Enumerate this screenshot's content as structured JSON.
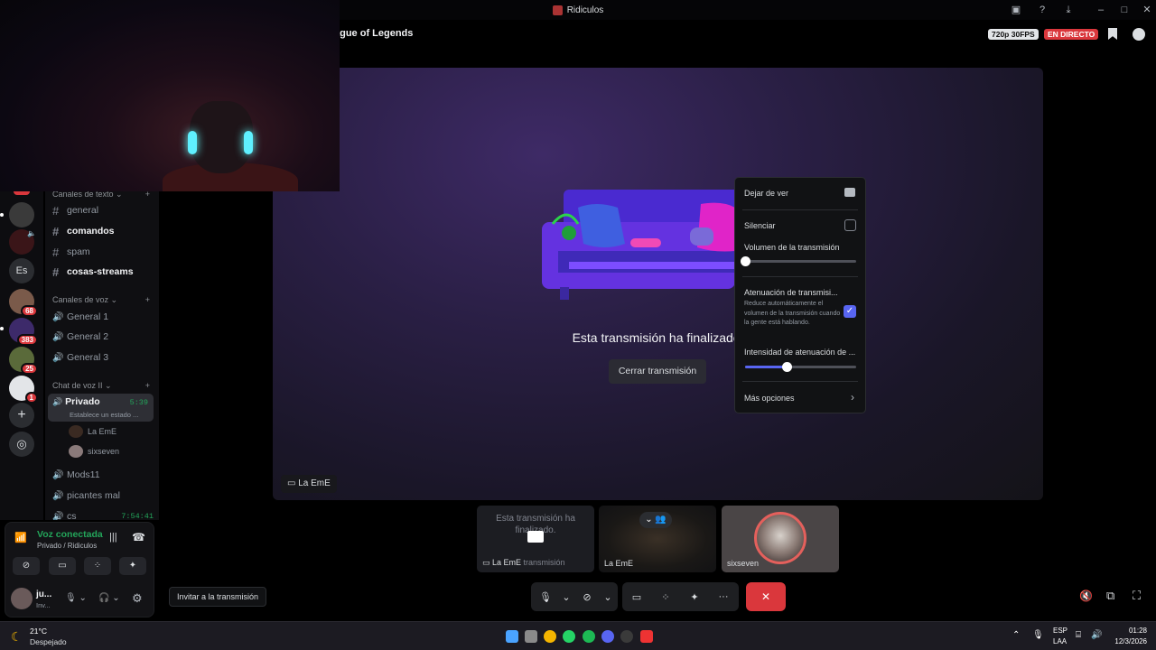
{
  "window": {
    "title": "Ridiculos"
  },
  "stream": {
    "title": "ague of Legends",
    "quality": "720p 30FPS",
    "live_badge": "EN DIRECTO",
    "ended_text": "Esta transmisión ha finalizado.",
    "close_button": "Cerrar transmisión",
    "streamer_tag": "La EmE"
  },
  "menu": {
    "stop_watching": "Dejar de ver",
    "mute": "Silenciar",
    "volume_label": "Volumen de la transmisión",
    "volume_value": 0.0,
    "attenuation_label": "Atenuación de transmisi...",
    "attenuation_desc": "Reduce automáticamente el volumen de la transmisión cuando la gente está hablando.",
    "attenuation_checked": true,
    "intensity_label": "Intensidad de atenuación de ...",
    "intensity_value": 0.37,
    "more_options": "Más opciones"
  },
  "sidebar": {
    "text_category": "Canales de texto",
    "text_channels": [
      {
        "name": "general",
        "bold": false
      },
      {
        "name": "comandos",
        "bold": true
      },
      {
        "name": "spam",
        "bold": false
      },
      {
        "name": "cosas-streams",
        "bold": true
      }
    ],
    "voice_category": "Canales de voz",
    "voice_channels": [
      "General 1",
      "General 2",
      "General 3"
    ],
    "chat_category": "Chat de voz II",
    "active_channel": {
      "name": "Privado",
      "time": "5:39",
      "status": "Establece un estado ..."
    },
    "members": [
      "La EmE",
      "sixseven"
    ],
    "other_channels": [
      {
        "name": "Mods11",
        "time": ""
      },
      {
        "name": "picantes mal",
        "time": ""
      },
      {
        "name": "cs",
        "time": "7:54:41"
      }
    ]
  },
  "servers": {
    "badges": [
      "68",
      "383",
      "25",
      "1"
    ],
    "text_icon": "Es"
  },
  "voice_panel": {
    "status": "Voz conectada",
    "location": "Privado / Ridiculos",
    "user_name": "ju...",
    "user_status": "Inv..."
  },
  "thumbnails": [
    {
      "label": "La EmE",
      "sublabel": "transmisión",
      "ended": "Esta transmisión ha finalizado."
    },
    {
      "label": "La EmE"
    },
    {
      "label": "sixseven"
    }
  ],
  "invite": "Invitar a la transmisión",
  "taskbar": {
    "weather_temp": "21°C",
    "weather_desc": "Despejado",
    "lang_top": "ESP",
    "lang_bottom": "LAA",
    "time": "01:28",
    "date": "12/3/2026"
  },
  "colors": {
    "accent": "#5865f2",
    "live": "#da373c",
    "voice_green": "#23a55a",
    "danger": "#da373c"
  }
}
